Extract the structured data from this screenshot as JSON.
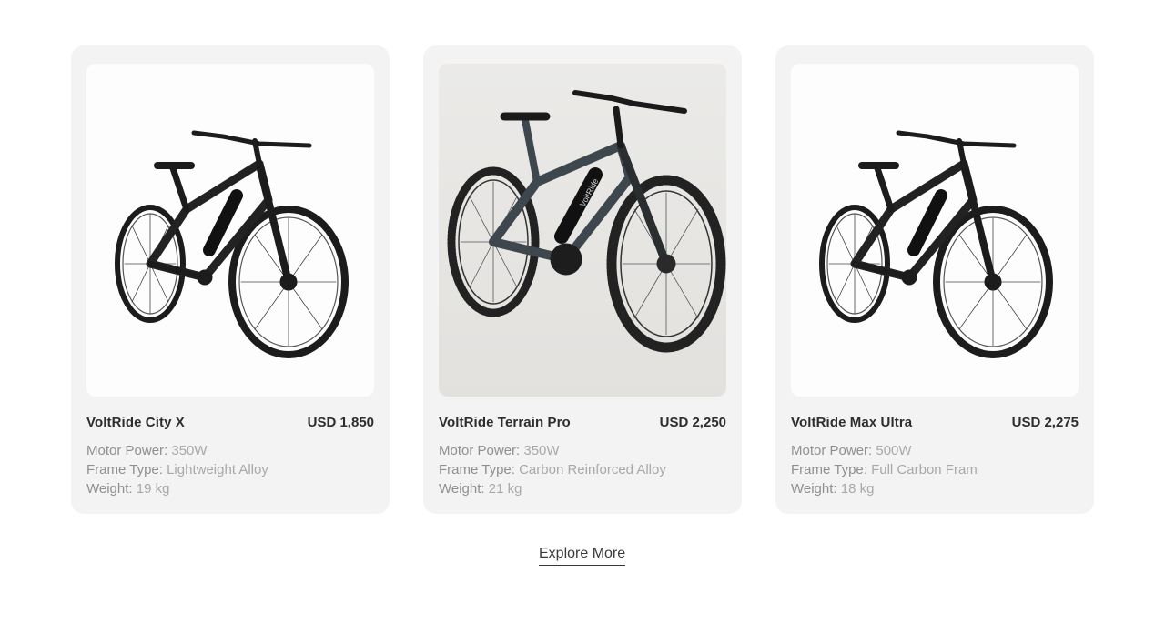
{
  "products": [
    {
      "name": "VoltRide City X",
      "price": "USD 1,850",
      "image_icon": "city-ebike-image",
      "specs": [
        {
          "label": "Motor Power:",
          "value": "350W"
        },
        {
          "label": "Frame Type:",
          "value": "Lightweight Alloy"
        },
        {
          "label": "Weight:",
          "value": "19 kg"
        }
      ]
    },
    {
      "name": "VoltRide Terrain Pro",
      "price": "USD 2,250",
      "image_icon": "mountain-ebike-image",
      "frame_text": "VoltRide",
      "specs": [
        {
          "label": "Motor Power:",
          "value": "350W"
        },
        {
          "label": "Frame Type:",
          "value": "Carbon Reinforced Alloy"
        },
        {
          "label": "Weight:",
          "value": "21 kg"
        }
      ]
    },
    {
      "name": "VoltRide Max Ultra",
      "price": "USD 2,275",
      "image_icon": "city-ebike-image",
      "specs": [
        {
          "label": "Motor Power:",
          "value": "500W"
        },
        {
          "label": "Frame Type:",
          "value": "Full Carbon Fram"
        },
        {
          "label": "Weight:",
          "value": "18 kg"
        }
      ]
    }
  ],
  "explore_label": "Explore More",
  "colors": {
    "card_bg": "#f3f3f3",
    "text_dark": "#2d2d2d",
    "text_muted": "#9a9a9a",
    "bike_black": "#1c1c1c",
    "bike_slate": "#3e474d"
  }
}
